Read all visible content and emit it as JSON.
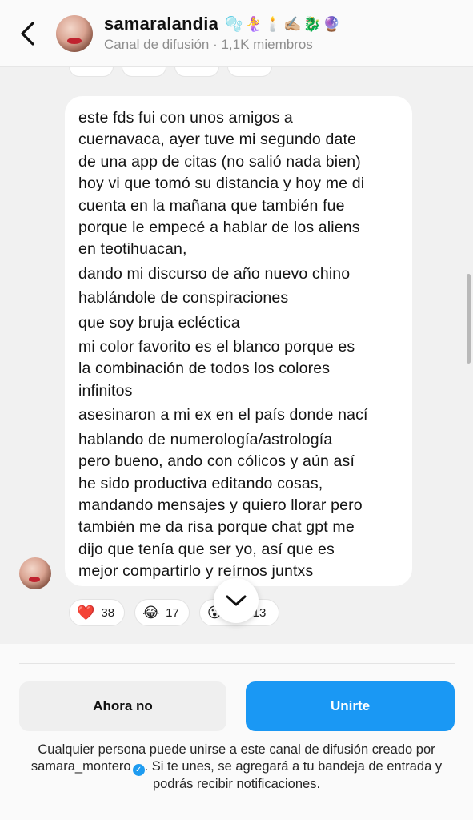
{
  "header": {
    "channel_name": "samaralandia",
    "channel_emojis": "🫧🧜‍♀️🕯️✍🏼🐉🔮",
    "subtitle": "Canal de difusión · 1,1K miembros"
  },
  "message": {
    "lines": [
      "este fds fui con unos amigos a",
      "cuernavaca, ayer tuve mi segundo date",
      "de una app de citas (no salió nada bien)",
      "hoy vi que tomó su distancia y hoy me di",
      "cuenta en la mañana que también fue",
      "porque le empecé a hablar de los aliens",
      "en teotihuacan,",
      "dando mi discurso de año nuevo chino",
      "hablándole de conspiraciones",
      "que soy bruja ecléctica",
      "mi color favorito es el blanco porque es",
      "la combinación de todos los colores",
      "infinitos",
      "asesinaron a mi ex en el país donde nací",
      "hablando de numerología/astrología",
      "pero bueno, ando con cólicos y aún así",
      "he sido productiva editando cosas,",
      "mandando mensajes y quiero llorar pero",
      "también me da risa porque chat gpt me",
      "dijo que tenía que ser yo, así que es",
      "mejor compartirlo y reírnos juntxs"
    ],
    "reactions": [
      {
        "emoji": "❤️",
        "count": "38"
      },
      {
        "emoji": "😂",
        "count": "17"
      },
      {
        "emoji": "😮",
        "count": "13"
      }
    ]
  },
  "footer": {
    "secondary_button": "Ahora no",
    "primary_button": "Unirte",
    "disclaimer_part1": "Cualquier persona puede unirse a este canal de difusión creado por samara_montero",
    "disclaimer_part2": ". Si te unes, se agregará a tu bandeja de entrada y podrás recibir notificaciones."
  },
  "colors": {
    "primary_button": "#1a98f4",
    "bubble_bg": "#ffffff",
    "chat_bg": "#f1f1f1",
    "verified_badge": "#1d9bf0"
  },
  "icons": [
    "chevron-left-icon",
    "chevron-down-icon",
    "verified-icon"
  ]
}
